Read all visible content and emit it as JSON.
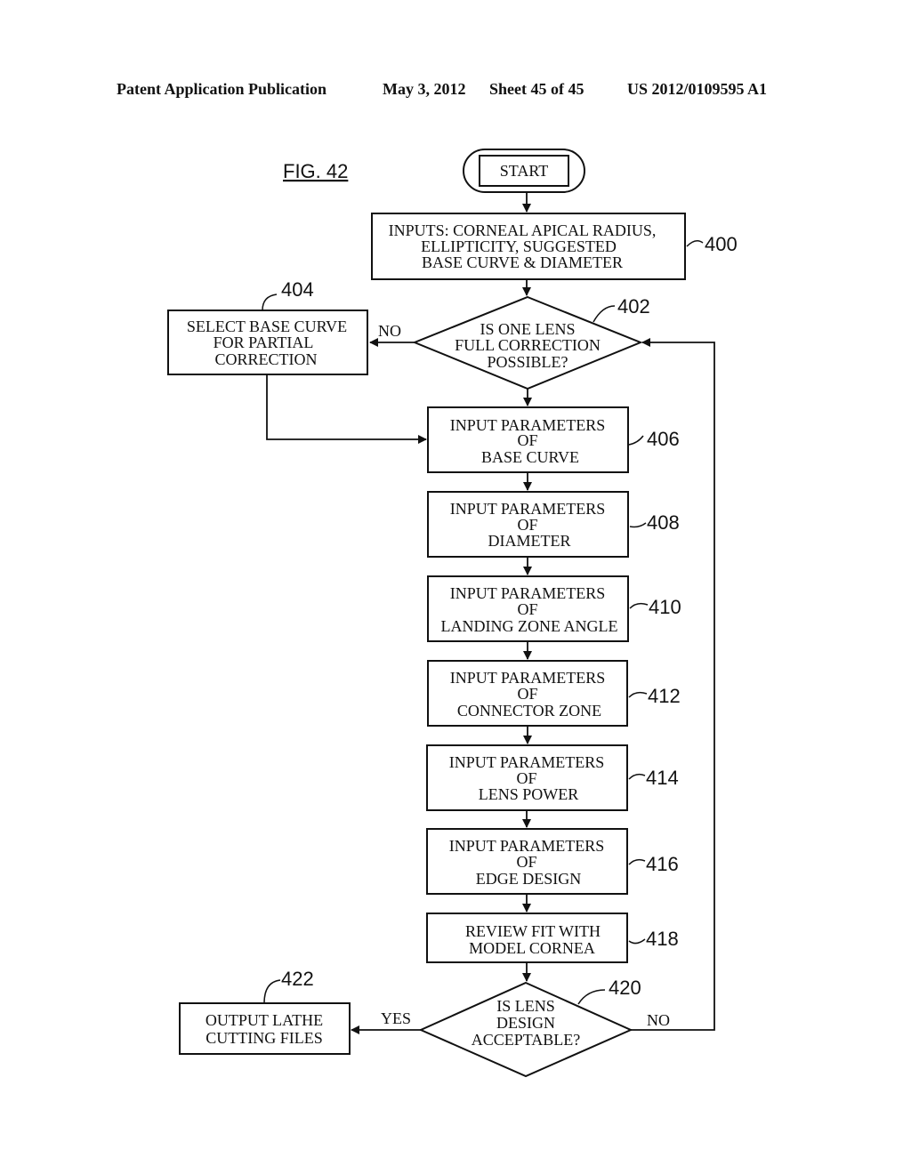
{
  "header": {
    "publication": "Patent Application Publication",
    "date": "May 3, 2012",
    "sheet": "Sheet 45 of 45",
    "number": "US 2012/0109595 A1"
  },
  "figure": {
    "label": "FIG. 42",
    "start": "START",
    "nodes": [
      {
        "id": "400",
        "ref": "400",
        "lines": [
          "INPUTS: CORNEAL APICAL RADIUS,",
          "ELLIPTICITY, SUGGESTED",
          "BASE CURVE & DIAMETER"
        ]
      },
      {
        "id": "402",
        "ref": "402",
        "lines": [
          "IS ONE LENS",
          "FULL CORRECTION",
          "POSSIBLE?"
        ]
      },
      {
        "id": "404",
        "ref": "404",
        "lines": [
          "SELECT BASE CURVE",
          "FOR PARTIAL",
          "CORRECTION"
        ]
      },
      {
        "id": "406",
        "ref": "406",
        "lines": [
          "INPUT PARAMETERS",
          "OF",
          "BASE CURVE"
        ]
      },
      {
        "id": "408",
        "ref": "408",
        "lines": [
          "INPUT PARAMETERS",
          "OF",
          "DIAMETER"
        ]
      },
      {
        "id": "410",
        "ref": "410",
        "lines": [
          "INPUT PARAMETERS",
          "OF",
          "LANDING ZONE ANGLE"
        ]
      },
      {
        "id": "412",
        "ref": "412",
        "lines": [
          "INPUT PARAMETERS",
          "OF",
          "CONNECTOR ZONE"
        ]
      },
      {
        "id": "414",
        "ref": "414",
        "lines": [
          "INPUT PARAMETERS",
          "OF",
          "LENS POWER"
        ]
      },
      {
        "id": "416",
        "ref": "416",
        "lines": [
          "INPUT PARAMETERS",
          "OF",
          "EDGE DESIGN"
        ]
      },
      {
        "id": "418",
        "ref": "418",
        "lines": [
          "REVIEW FIT WITH",
          "MODEL CORNEA"
        ]
      },
      {
        "id": "420",
        "ref": "420",
        "lines": [
          "IS LENS",
          "DESIGN",
          "ACCEPTABLE?"
        ]
      },
      {
        "id": "422",
        "ref": "422",
        "lines": [
          "OUTPUT LATHE",
          "CUTTING FILES"
        ]
      }
    ],
    "edge_labels": {
      "no_402": "NO",
      "yes_420": "YES",
      "no_420": "NO"
    }
  }
}
